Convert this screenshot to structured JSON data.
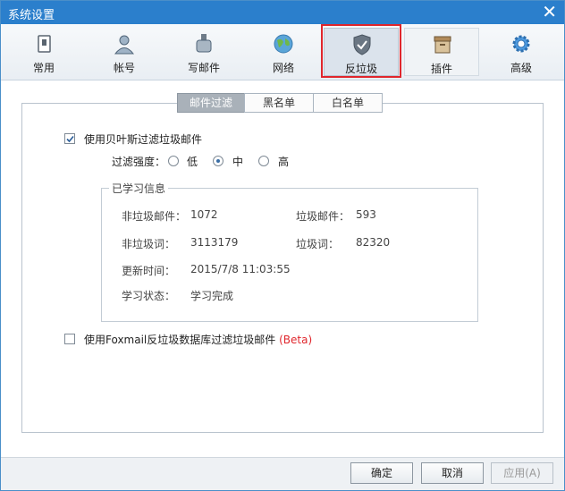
{
  "window": {
    "title": "系统设置",
    "close_glyph": "✕"
  },
  "toolbar": [
    {
      "label": "常用",
      "icon": "phone-icon"
    },
    {
      "label": "帐号",
      "icon": "user-icon"
    },
    {
      "label": "写邮件",
      "icon": "compose-icon"
    },
    {
      "label": "网络",
      "icon": "globe-icon"
    },
    {
      "label": "反垃圾",
      "icon": "shield-icon",
      "selected": true
    },
    {
      "label": "插件",
      "icon": "plugin-box-icon"
    },
    {
      "label": "高级",
      "icon": "gear-icon"
    }
  ],
  "tabs": [
    {
      "label": "邮件过滤",
      "selected": true
    },
    {
      "label": "黑名单",
      "selected": false
    },
    {
      "label": "白名单",
      "selected": false
    }
  ],
  "bayes": {
    "checkbox_label": "使用贝叶斯过滤垃圾邮件",
    "checked": true,
    "strength_label": "过滤强度：",
    "levels": [
      {
        "label": "低",
        "selected": false
      },
      {
        "label": "中",
        "selected": true
      },
      {
        "label": "高",
        "selected": false
      }
    ]
  },
  "learned": {
    "group_title": "已学习信息",
    "ham_mail_label": "非垃圾邮件：",
    "ham_mail_value": "1072",
    "spam_mail_label": "垃圾邮件：",
    "spam_mail_value": "593",
    "ham_word_label": "非垃圾词：",
    "ham_word_value": "3113179",
    "spam_word_label": "垃圾词：",
    "spam_word_value": "82320",
    "updated_label": "更新时间：",
    "updated_value": "2015/7/8 11:03:55",
    "status_label": "学习状态：",
    "status_value": "学习完成"
  },
  "foxmail_db": {
    "checkbox_label": "使用Foxmail反垃圾数据库过滤垃圾邮件",
    "beta": "(Beta)",
    "checked": false
  },
  "buttons": {
    "ok": "确定",
    "cancel": "取消",
    "apply": "应用(A)"
  },
  "colors": {
    "titlebar": "#2b7fcc",
    "highlight_box": "#e0262c",
    "selected_tab": "#a9b1b9"
  }
}
